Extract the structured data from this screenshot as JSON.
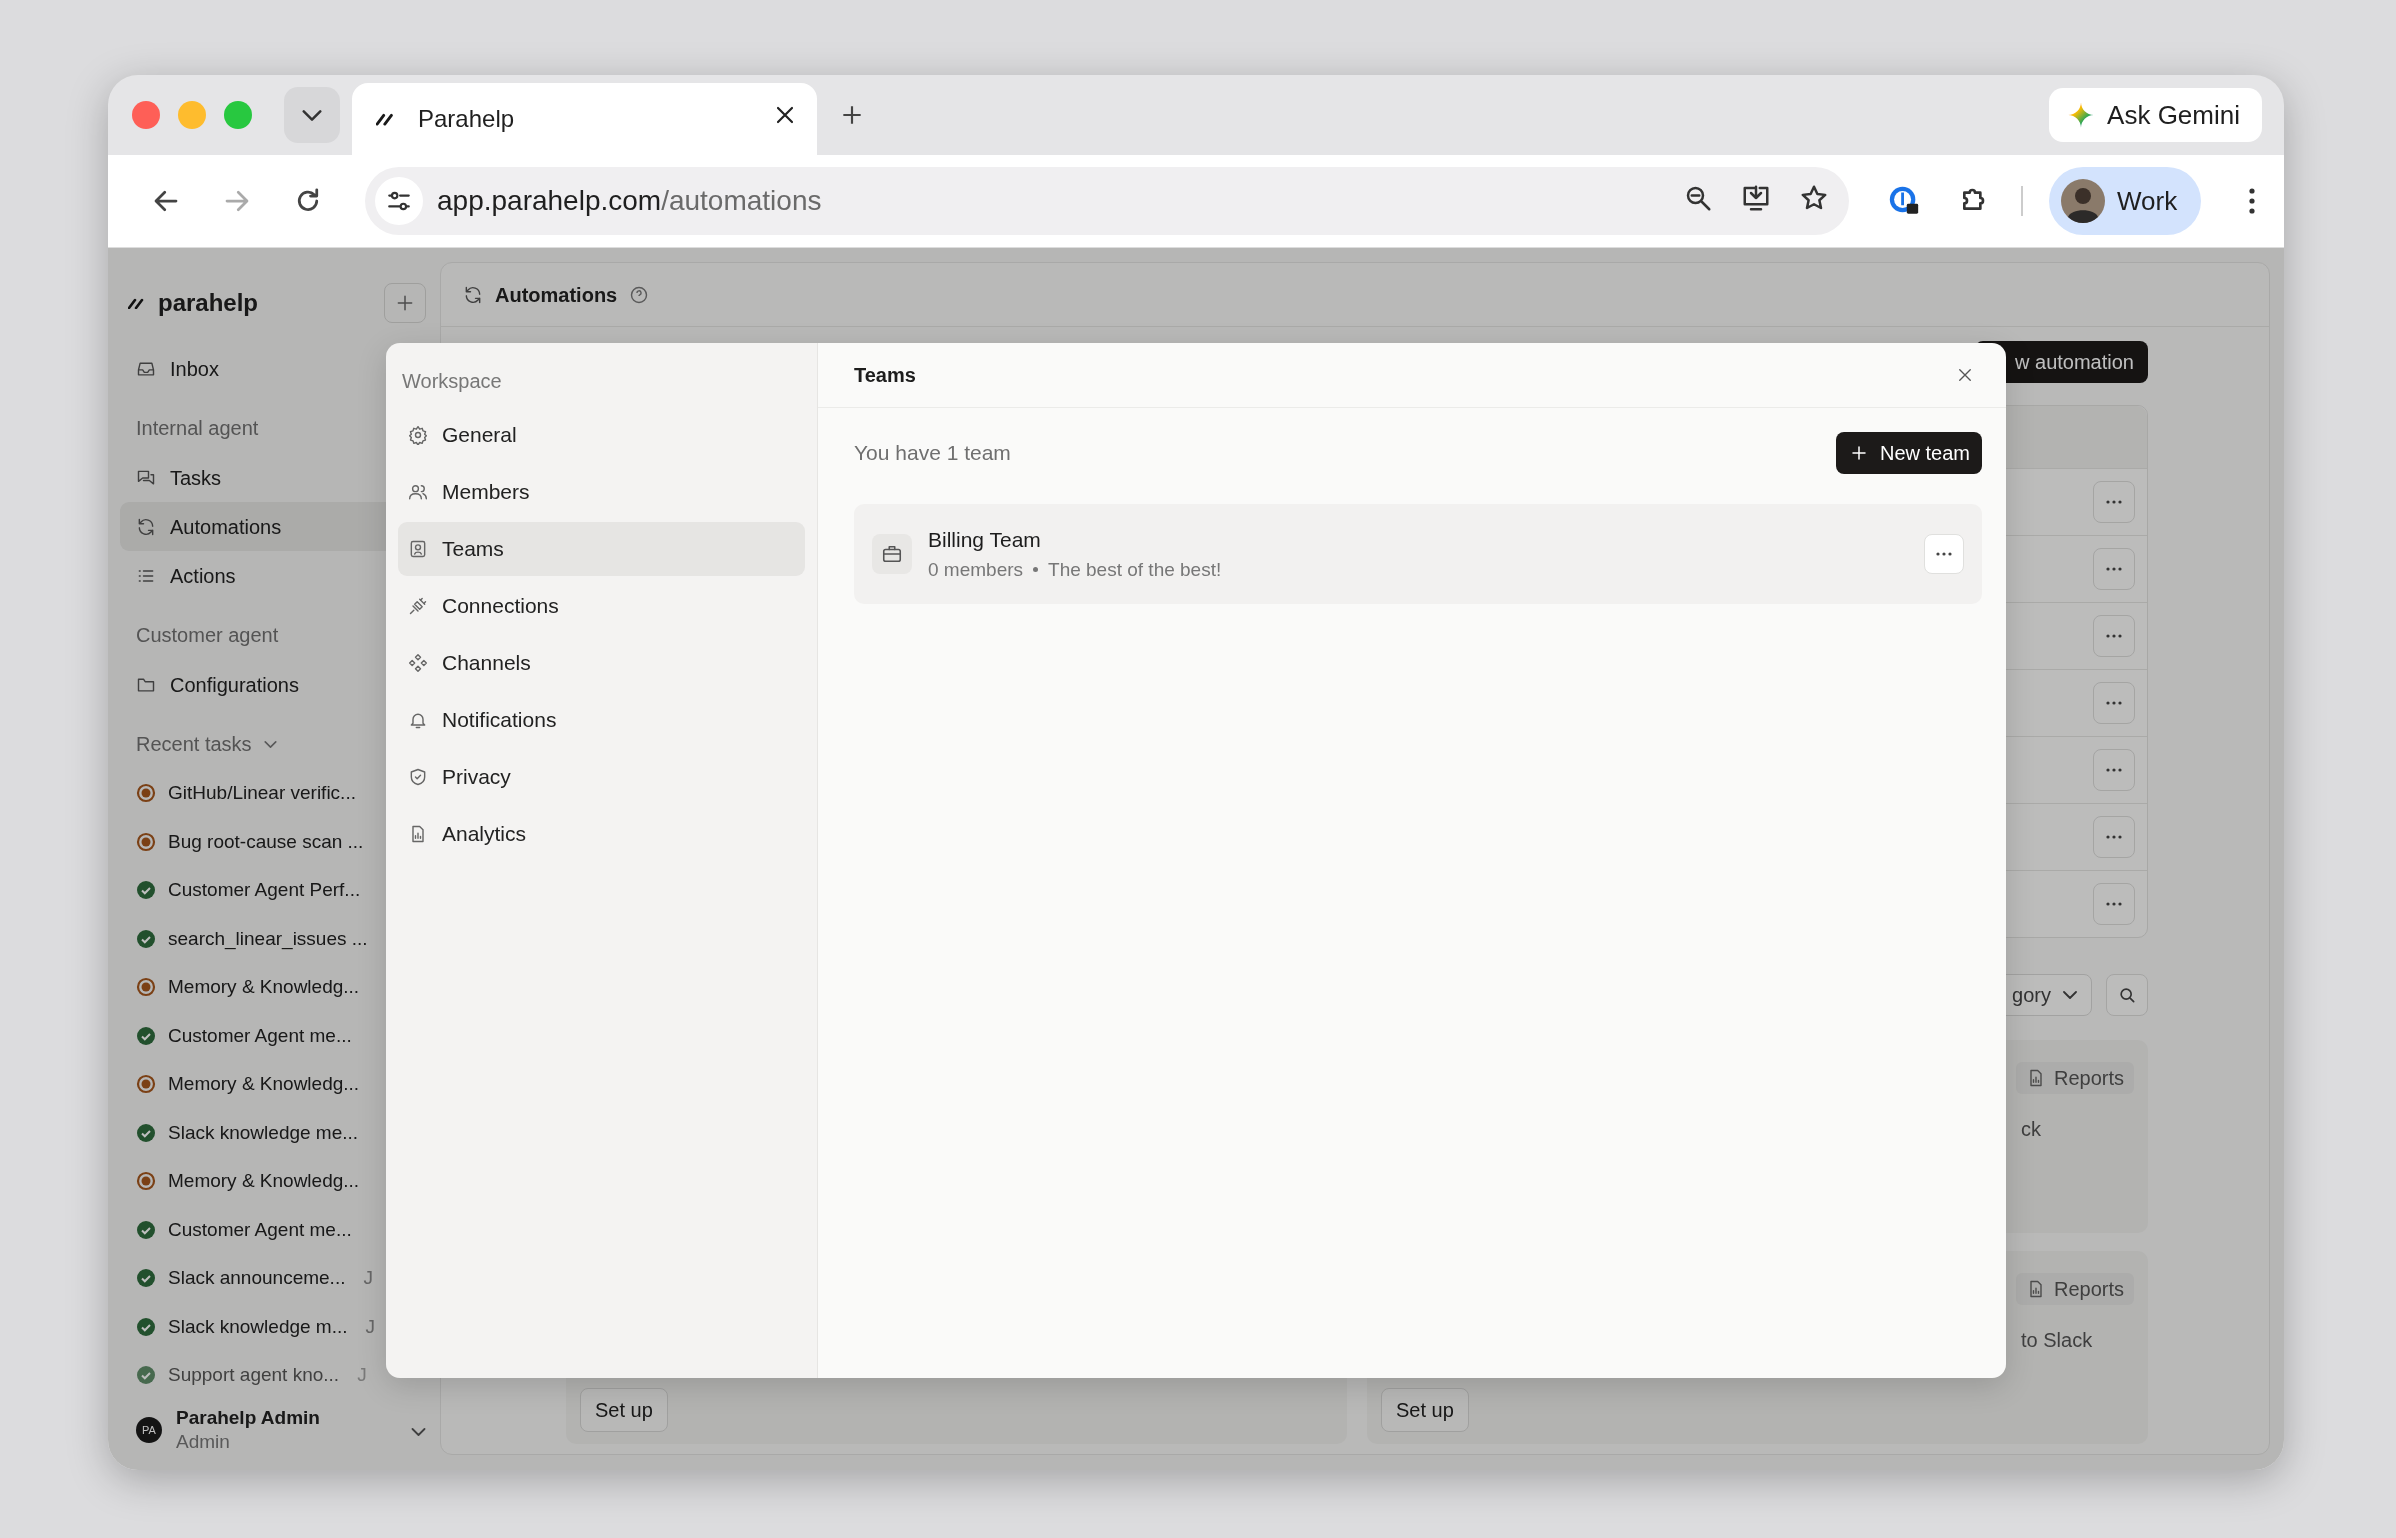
{
  "browser": {
    "tab_title": "Parahelp",
    "ask_gemini": "Ask Gemini",
    "url_host": "app.parahelp.com",
    "url_path": "/automations",
    "profile": "Work",
    "forward_disabled": true
  },
  "sidebar": {
    "brand": "parahelp",
    "inbox": "Inbox",
    "sections": [
      {
        "title": "Internal agent",
        "items": [
          {
            "label": "Tasks",
            "selected": false
          },
          {
            "label": "Automations",
            "selected": true
          },
          {
            "label": "Actions",
            "selected": false
          }
        ]
      },
      {
        "title": "Customer agent",
        "items": [
          {
            "label": "Configurations",
            "selected": false
          }
        ]
      }
    ],
    "recent_title": "Recent tasks",
    "recent": [
      {
        "label": "GitHub/Linear verific...",
        "done": false
      },
      {
        "label": "Bug root-cause scan ...",
        "done": false
      },
      {
        "label": "Customer Agent Perf...",
        "done": true
      },
      {
        "label": "search_linear_issues ...",
        "done": true
      },
      {
        "label": "Memory & Knowledg...",
        "done": false
      },
      {
        "label": "Customer Agent me...",
        "done": true
      },
      {
        "label": "Memory & Knowledg...",
        "done": false
      },
      {
        "label": "Slack knowledge me...",
        "done": true
      },
      {
        "label": "Memory & Knowledg...",
        "done": false
      },
      {
        "label": "Customer Agent me...",
        "done": true
      },
      {
        "label": "Slack announceme...",
        "done": true,
        "date": "J"
      },
      {
        "label": "Slack knowledge m...",
        "done": true,
        "date": "J"
      },
      {
        "label": "Support agent kno...",
        "done": true,
        "date": "J"
      }
    ],
    "user": {
      "initials": "PA",
      "name": "Parahelp Admin",
      "role": "Admin"
    }
  },
  "page": {
    "title": "Automations",
    "new_button": "w automation",
    "table_rows": [
      {
        "kind": "automation"
      },
      {
        "kind": "automation"
      },
      {
        "kind": "automation"
      },
      {
        "kind": "automation"
      },
      {
        "kind": "automation"
      },
      {
        "kind": "automation"
      },
      {
        "kind": "automation"
      }
    ],
    "filter_label": "gory",
    "cards": [
      {
        "kind": "automation_card",
        "tag": "Reports",
        "text": "ck"
      },
      {
        "kind": "automation_card",
        "setup": "Set up"
      },
      {
        "kind": "automation_card",
        "tag": "Reports",
        "text": "to Slack",
        "setup": "Set up"
      }
    ]
  },
  "modal": {
    "section": "Workspace",
    "nav": [
      {
        "label": "General",
        "selected": false
      },
      {
        "label": "Members",
        "selected": false
      },
      {
        "label": "Teams",
        "selected": true
      },
      {
        "label": "Connections",
        "selected": false
      },
      {
        "label": "Channels",
        "selected": false
      },
      {
        "label": "Notifications",
        "selected": false
      },
      {
        "label": "Privacy",
        "selected": false
      },
      {
        "label": "Analytics",
        "selected": false
      }
    ],
    "title": "Teams",
    "count_text": "You have 1 team",
    "new_button": "New team",
    "teams": [
      {
        "name": "Billing Team",
        "members": "0 members",
        "description": "The best of the best!"
      }
    ]
  }
}
